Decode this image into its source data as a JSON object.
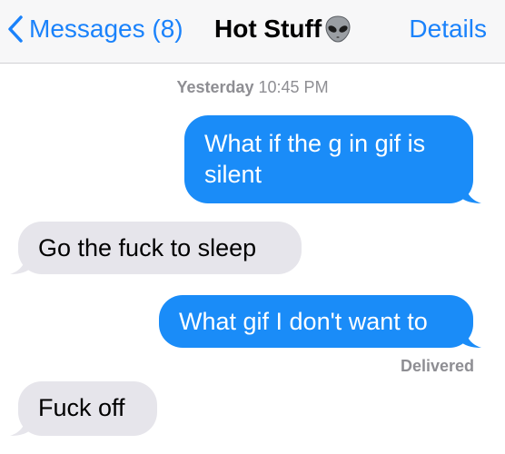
{
  "nav": {
    "back_label": "Messages (8)",
    "title": "Hot Stuff",
    "details_label": "Details"
  },
  "timestamp": {
    "day": "Yesterday",
    "time": "10:45 PM"
  },
  "messages": [
    {
      "direction": "sent",
      "text": "What if the g in gif is silent"
    },
    {
      "direction": "received",
      "text": "Go the fuck to sleep"
    },
    {
      "direction": "sent",
      "text": "What gif I don't want to"
    },
    {
      "direction": "received",
      "text": "Fuck off"
    }
  ],
  "status": {
    "delivered": "Delivered"
  },
  "colors": {
    "accent": "#1a82fb",
    "sent_bubble": "#1a8cf8",
    "received_bubble": "#e6e5eb"
  },
  "icons": {
    "back": "chevron-left-icon",
    "title_emoji": "alien-icon"
  }
}
